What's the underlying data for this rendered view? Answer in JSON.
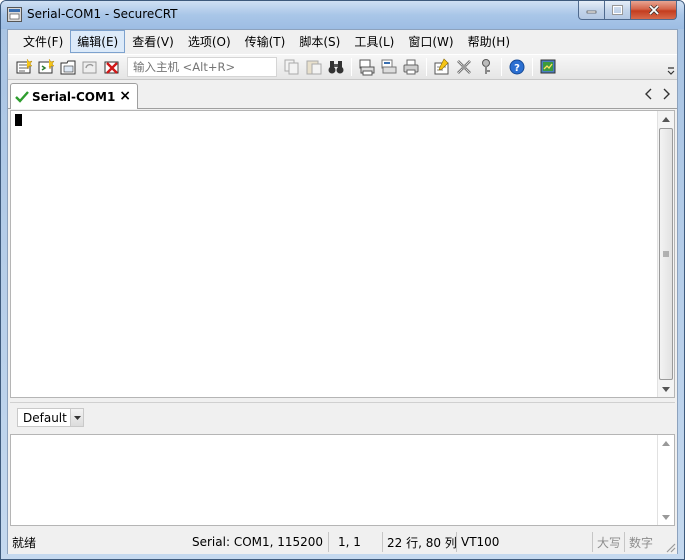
{
  "window": {
    "title": "Serial-COM1 - SecureCRT"
  },
  "menu": {
    "items": [
      {
        "label": "文件(F)"
      },
      {
        "label": "编辑(E)"
      },
      {
        "label": "查看(V)"
      },
      {
        "label": "选项(O)"
      },
      {
        "label": "传输(T)"
      },
      {
        "label": "脚本(S)"
      },
      {
        "label": "工具(L)"
      },
      {
        "label": "窗口(W)"
      },
      {
        "label": "帮助(H)"
      }
    ]
  },
  "toolbar": {
    "host_placeholder": "输入主机 <Alt+R>"
  },
  "tabs": [
    {
      "label": "Serial-COM1",
      "close": "×"
    }
  ],
  "command_bar": {
    "session": "Default"
  },
  "status": {
    "ready": "就绪",
    "connection": "Serial: COM1, 115200",
    "cursor_pos": "1,   1",
    "size": "22 行, 80 列",
    "emulation": "VT100",
    "caps": "大写",
    "num": "数字"
  },
  "colors": {
    "accent": "#dceaf9",
    "tab_check": "#2e9d2e",
    "close_button": "#c43d1f"
  }
}
